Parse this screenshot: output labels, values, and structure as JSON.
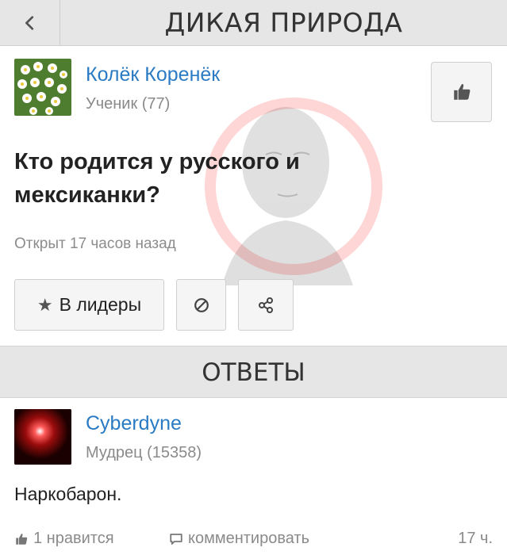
{
  "header": {
    "title": "ДИКАЯ ПРИРОДА",
    "back_icon": "chevron-left-icon"
  },
  "question": {
    "author": {
      "name": "Колёк Коренёк",
      "rank": "Ученик (77)"
    },
    "text": "Кто родится у русского и мексиканки?",
    "opened": "Открыт 17 часов назад",
    "actions": {
      "leaders_label": "В лидеры",
      "leaders_icon": "star-icon",
      "block_icon": "ban-icon",
      "share_icon": "share-icon"
    },
    "like_icon": "thumbs-up-icon"
  },
  "answers_section": {
    "title": "ОТВЕТЫ"
  },
  "answer": {
    "author": {
      "name": "Cyberdyne",
      "rank": "Мудрец (15358)"
    },
    "text": "Наркобарон.",
    "likes": "1 нравится",
    "comment_label": "комментировать",
    "time": "17 ч."
  },
  "colors": {
    "link": "#2a7bc4",
    "header_bg": "#e6e6e6",
    "muted": "#8a8a8a",
    "watermark": "#ff3b3b"
  }
}
